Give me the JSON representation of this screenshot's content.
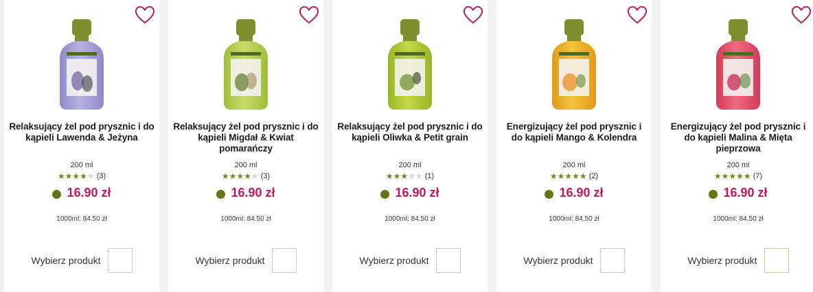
{
  "colors": {
    "price": "#c2185b",
    "heart": "#b8225c",
    "star_filled": "#6b8a22",
    "star_empty": "#d6d6d6",
    "availability_dot": "#5f7a14"
  },
  "products": [
    {
      "title": "Relaksujący żel pod prysznic i do kąpieli Lawenda & Jeżyna",
      "volume": "200 ml",
      "rating": 4,
      "rating_count": "(3)",
      "price": "16.90 zł",
      "unit_price": "1000ml: 84.50 zł",
      "select_label": "Wybierz produkt",
      "liquid_color": "#b7b3e0",
      "liquid_color_dark": "#8f89c9",
      "icon": "heart-icon"
    },
    {
      "title": "Relaksujący żel pod prysznic i do kąpieli Migdał & Kwiat pomarańczy",
      "volume": "200 ml",
      "rating": 4,
      "rating_count": "(3)",
      "price": "16.90 zł",
      "unit_price": "1000ml: 84.50 zł",
      "select_label": "Wybierz produkt",
      "liquid_color": "#c8dc6a",
      "liquid_color_dark": "#9fbd3a",
      "icon": "heart-icon"
    },
    {
      "title": "Relaksujący żel pod prysznic i do kąpieli Oliwka & Petit grain",
      "volume": "200 ml",
      "rating": 3,
      "rating_count": "(1)",
      "price": "16.90 zł",
      "unit_price": "1000ml: 84.50 zł",
      "select_label": "Wybierz produkt",
      "liquid_color": "#c5d84a",
      "liquid_color_dark": "#98b524",
      "icon": "heart-icon"
    },
    {
      "title": "Energizujący żel pod prysznic i do kąpieli Mango & Kolendra",
      "volume": "200 ml",
      "rating": 5,
      "rating_count": "(2)",
      "price": "16.90 zł",
      "unit_price": "1000ml: 84.50 zł",
      "select_label": "Wybierz produkt",
      "liquid_color": "#f3c43c",
      "liquid_color_dark": "#e09a1c",
      "icon": "heart-icon"
    },
    {
      "title": "Energizujący żel pod prysznic i do kąpieli Malina & Mięta pieprzowa",
      "volume": "200 ml",
      "rating": 5,
      "rating_count": "(7)",
      "price": "16.90 zł",
      "unit_price": "1000ml: 84.50 zł",
      "select_label": "Wybierz produkt",
      "liquid_color": "#f06a80",
      "liquid_color_dark": "#d23b58",
      "icon": "heart-icon"
    }
  ]
}
